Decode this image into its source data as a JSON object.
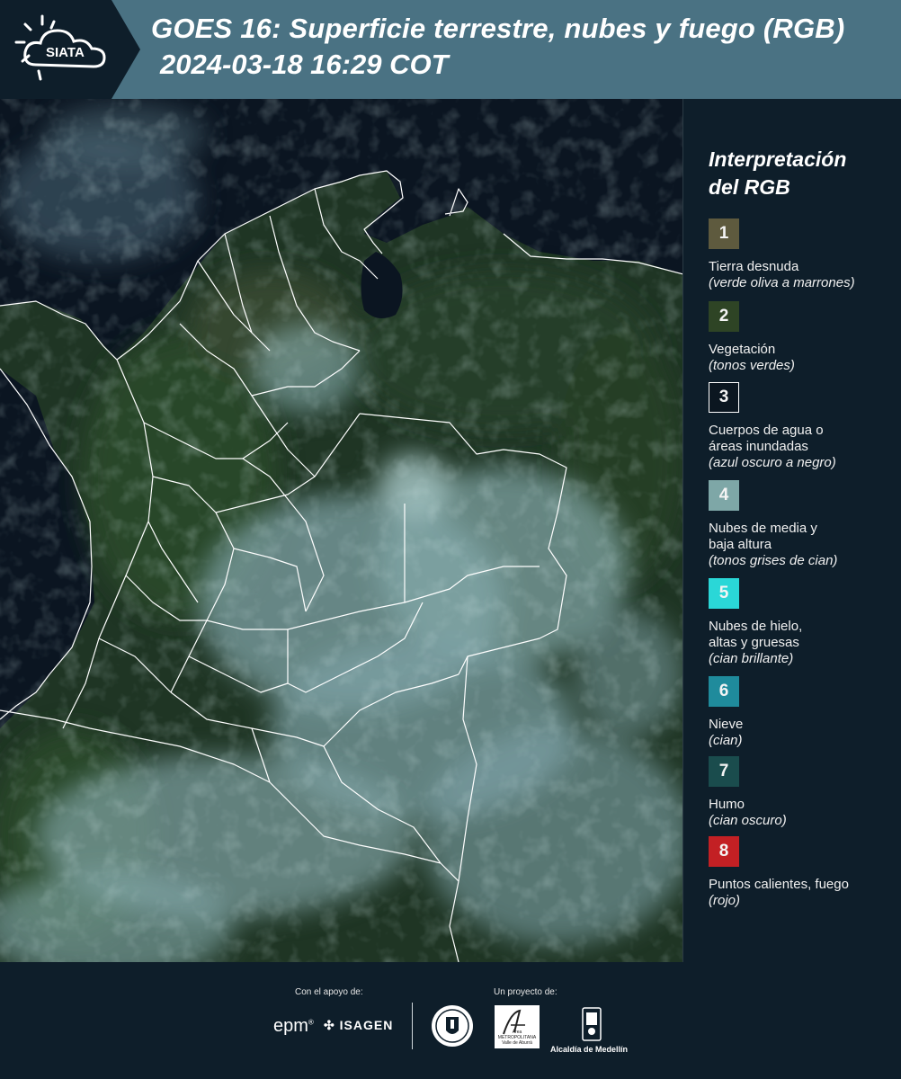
{
  "header": {
    "logo_text": "SIATA",
    "title_line1": "GOES 16: Superficie terrestre, nubes y fuego (RGB)",
    "title_line2": "2024-03-18 16:29 COT"
  },
  "legend": {
    "title_line1": "Interpretación",
    "title_line2": "del RGB",
    "items": [
      {
        "number": "1",
        "label": "Tierra desnuda",
        "desc": "(verde oliva a marrones)",
        "color": "#5e5a3e"
      },
      {
        "number": "2",
        "label": "Vegetación",
        "desc": "(tonos verdes)",
        "color": "#2e4425"
      },
      {
        "number": "3",
        "label": "Cuerpos de agua o áreas inundadas",
        "desc": "(azul oscuro a negro)",
        "color": "#0b1620"
      },
      {
        "number": "4",
        "label": "Nubes de media y baja altura",
        "desc": "(tonos grises de cian)",
        "color": "#7ea7a7"
      },
      {
        "number": "5",
        "label": "Nubes de hielo, altas y gruesas",
        "desc": "(cian brillante)",
        "color": "#2ad7d7"
      },
      {
        "number": "6",
        "label": "Nieve",
        "desc": "(cian)",
        "color": "#1f8b9c"
      },
      {
        "number": "7",
        "label": "Humo",
        "desc": "(cian oscuro)",
        "color": "#1a4c4d"
      },
      {
        "number": "8",
        "label": "Puntos calientes, fuego",
        "desc": "(rojo)",
        "color": "#c32024"
      }
    ]
  },
  "footer": {
    "support_label": "Con el apoyo de:",
    "project_label": "Un proyecto de:",
    "epm": "epm",
    "isagen": "ISAGEN",
    "area": "Área METROPOLITANA Valle de Aburrá",
    "alcaldia": "Alcaldía de Medellín"
  }
}
